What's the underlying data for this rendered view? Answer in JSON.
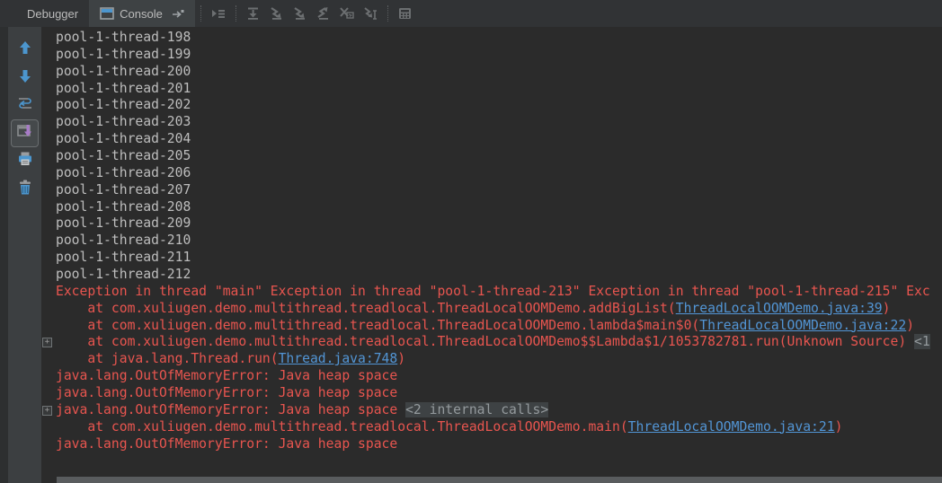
{
  "colors": {
    "console_background": "#2b2b2b",
    "panel_background": "#3c3f41",
    "header_background": "#313335",
    "selected_tab_background": "#3e4244",
    "error_text": "#e8554f",
    "link_text": "#5295d5",
    "normal_text": "#bdbdbd",
    "muted_text": "#949a9d",
    "muted_highlight": "#3e4244",
    "accent_blue_icon": "#4c96ce",
    "purple_arrow": "#a87bc8",
    "scrollbar_thumb": "#595c5e"
  },
  "header": {
    "tabs": [
      {
        "label": "Debugger",
        "selected": false
      },
      {
        "label": "Console",
        "selected": true
      }
    ],
    "toolbar_icons": [
      "show-execution-point",
      "step-over",
      "step-into",
      "force-step-into",
      "step-out",
      "drop-frame",
      "run-to-cursor",
      "evaluate-expression"
    ]
  },
  "sidebar": {
    "icons": [
      {
        "name": "up-the-stack-trace",
        "selected": false
      },
      {
        "name": "down-the-stack-trace",
        "selected": false
      },
      {
        "name": "use-soft-wraps",
        "selected": false
      },
      {
        "name": "scroll-to-the-end",
        "selected": true
      },
      {
        "name": "print",
        "selected": false
      },
      {
        "name": "clear-all",
        "selected": false
      }
    ]
  },
  "console": {
    "lines": [
      {
        "segments": [
          {
            "style": "normal",
            "text": "pool-1-thread-198"
          }
        ]
      },
      {
        "segments": [
          {
            "style": "normal",
            "text": "pool-1-thread-199"
          }
        ]
      },
      {
        "segments": [
          {
            "style": "normal",
            "text": "pool-1-thread-200"
          }
        ]
      },
      {
        "segments": [
          {
            "style": "normal",
            "text": "pool-1-thread-201"
          }
        ]
      },
      {
        "segments": [
          {
            "style": "normal",
            "text": "pool-1-thread-202"
          }
        ]
      },
      {
        "segments": [
          {
            "style": "normal",
            "text": "pool-1-thread-203"
          }
        ]
      },
      {
        "segments": [
          {
            "style": "normal",
            "text": "pool-1-thread-204"
          }
        ]
      },
      {
        "segments": [
          {
            "style": "normal",
            "text": "pool-1-thread-205"
          }
        ]
      },
      {
        "segments": [
          {
            "style": "normal",
            "text": "pool-1-thread-206"
          }
        ]
      },
      {
        "segments": [
          {
            "style": "normal",
            "text": "pool-1-thread-207"
          }
        ]
      },
      {
        "segments": [
          {
            "style": "normal",
            "text": "pool-1-thread-208"
          }
        ]
      },
      {
        "segments": [
          {
            "style": "normal",
            "text": "pool-1-thread-209"
          }
        ]
      },
      {
        "segments": [
          {
            "style": "normal",
            "text": "pool-1-thread-210"
          }
        ]
      },
      {
        "segments": [
          {
            "style": "normal",
            "text": "pool-1-thread-211"
          }
        ]
      },
      {
        "segments": [
          {
            "style": "normal",
            "text": "pool-1-thread-212"
          }
        ]
      },
      {
        "segments": [
          {
            "style": "error",
            "text": "Exception in thread \"main\" Exception in thread \"pool-1-thread-213\" Exception in thread \"pool-1-thread-215\" Exc"
          }
        ]
      },
      {
        "segments": [
          {
            "style": "error",
            "text": "    at com.xuliugen.demo.multithread.treadlocal.ThreadLocalOOMDemo.addBigList("
          },
          {
            "style": "link",
            "text": "ThreadLocalOOMDemo.java:39"
          },
          {
            "style": "error",
            "text": ")"
          }
        ]
      },
      {
        "segments": [
          {
            "style": "error",
            "text": "    at com.xuliugen.demo.multithread.treadlocal.ThreadLocalOOMDemo.lambda$main$0("
          },
          {
            "style": "link",
            "text": "ThreadLocalOOMDemo.java:22"
          },
          {
            "style": "error",
            "text": ")"
          }
        ]
      },
      {
        "fold": true,
        "segments": [
          {
            "style": "error",
            "text": "    at com.xuliugen.demo.multithread.treadlocal.ThreadLocalOOMDemo$$Lambda$1/1053782781.run(Unknown Source) "
          },
          {
            "style": "muted",
            "text": "<1"
          }
        ]
      },
      {
        "segments": [
          {
            "style": "error",
            "text": "    at java.lang.Thread.run("
          },
          {
            "style": "link",
            "text": "Thread.java:748"
          },
          {
            "style": "error",
            "text": ")"
          }
        ]
      },
      {
        "segments": [
          {
            "style": "error",
            "text": "java.lang.OutOfMemoryError: Java heap space"
          }
        ]
      },
      {
        "segments": [
          {
            "style": "error",
            "text": "java.lang.OutOfMemoryError: Java heap space"
          }
        ]
      },
      {
        "fold": true,
        "segments": [
          {
            "style": "error",
            "text": "java.lang.OutOfMemoryError: Java heap space "
          },
          {
            "style": "muted",
            "text": "<2 internal calls>"
          }
        ]
      },
      {
        "segments": [
          {
            "style": "error",
            "text": "    at com.xuliugen.demo.multithread.treadlocal.ThreadLocalOOMDemo.main("
          },
          {
            "style": "link",
            "text": "ThreadLocalOOMDemo.java:21"
          },
          {
            "style": "error",
            "text": ")"
          }
        ]
      },
      {
        "segments": [
          {
            "style": "error",
            "text": "java.lang.OutOfMemoryError: Java heap space"
          }
        ]
      }
    ]
  }
}
